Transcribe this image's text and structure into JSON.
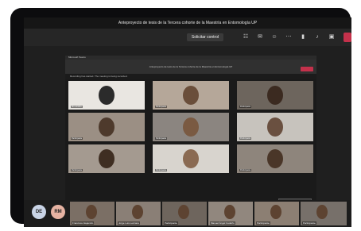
{
  "meeting": {
    "title": "Anteproyecto de tesis de la Tercera cohorte de la Maestría en Entomología UP"
  },
  "controls": {
    "share_label": "Solicitar control"
  },
  "shared_screen": {
    "window_title": "Microsoft Teams",
    "meeting_title": "Anteproyecto de tesis de la Tercera cohorte de la Maestría en Entomología UP",
    "notice": "Recording has started. The meeting is being recorded.",
    "grid": [
      {
        "name": "Sin nombre"
      },
      {
        "name": "Participante"
      },
      {
        "name": "Participante"
      },
      {
        "name": "Participante"
      },
      {
        "name": "Participante"
      },
      {
        "name": "Participante"
      },
      {
        "name": "Participante"
      },
      {
        "name": "Participante"
      },
      {
        "name": "Participante"
      }
    ]
  },
  "participants": {
    "avatars": [
      {
        "initials": "DE",
        "color": "#c9d4e6"
      },
      {
        "initials": "RM",
        "color": "#e6b3a3"
      }
    ],
    "videos": [
      {
        "name": "Francisco Alejandro"
      },
      {
        "name": "Jorge Luis Lezcano"
      },
      {
        "name": "Participante"
      },
      {
        "name": "Manuel Ángel Cedeño"
      },
      {
        "name": "Participante"
      },
      {
        "name": "Participante"
      }
    ]
  }
}
